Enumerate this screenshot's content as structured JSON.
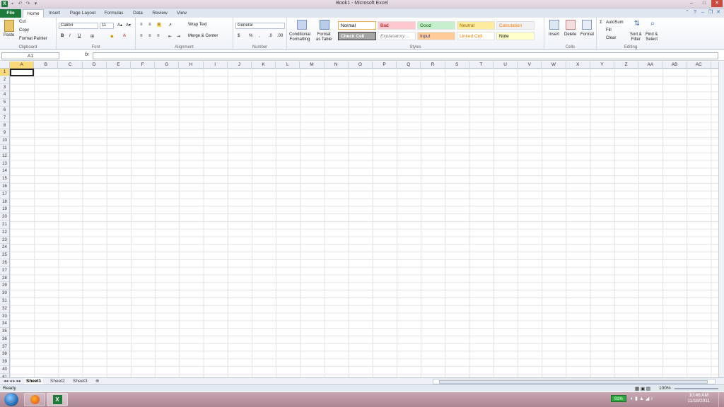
{
  "window": {
    "title": "Book1 - Microsoft Excel"
  },
  "tabs": [
    "File",
    "Home",
    "Insert",
    "Page Layout",
    "Formulas",
    "Data",
    "Review",
    "View"
  ],
  "ribbon": {
    "clipboard": {
      "label": "Clipboard",
      "paste": "Paste",
      "cut": "Cut",
      "copy": "Copy",
      "format_painter": "Format Painter"
    },
    "font": {
      "label": "Font",
      "family": "Calibri",
      "size": "11"
    },
    "alignment": {
      "label": "Alignment",
      "wrap": "Wrap Text",
      "merge": "Merge & Center"
    },
    "number": {
      "label": "Number",
      "format": "General"
    },
    "styles": {
      "label": "Styles",
      "conditional": "Conditional\nFormatting",
      "format_table": "Format\nas Table",
      "cells": [
        {
          "name": "Normal",
          "bg": "#ffffff",
          "fg": "#000000"
        },
        {
          "name": "Bad",
          "bg": "#ffc7ce",
          "fg": "#9c0006"
        },
        {
          "name": "Good",
          "bg": "#c6efce",
          "fg": "#006100"
        },
        {
          "name": "Neutral",
          "bg": "#ffeb9c",
          "fg": "#9c6500"
        },
        {
          "name": "Calculation",
          "bg": "#f2f2f2",
          "fg": "#fa7d00"
        },
        {
          "name": "Check Cell",
          "bg": "#a5a5a5",
          "fg": "#ffffff"
        },
        {
          "name": "Explanatory ...",
          "bg": "#ffffff",
          "fg": "#7f7f7f"
        },
        {
          "name": "Input",
          "bg": "#ffcc99",
          "fg": "#3f3f76"
        },
        {
          "name": "Linked Cell",
          "bg": "#ffffff",
          "fg": "#fa7d00"
        },
        {
          "name": "Note",
          "bg": "#ffffcc",
          "fg": "#000000"
        }
      ]
    },
    "cells": {
      "label": "Cells",
      "insert": "Insert",
      "delete": "Delete",
      "format": "Format"
    },
    "editing": {
      "label": "Editing",
      "autosum": "AutoSum",
      "fill": "Fill",
      "clear": "Clear",
      "sort": "Sort &\nFilter",
      "find": "Find &\nSelect"
    }
  },
  "formula_bar": {
    "name_box": "A1",
    "fx": "fx",
    "value": ""
  },
  "columns": [
    "A",
    "B",
    "C",
    "D",
    "E",
    "F",
    "G",
    "H",
    "I",
    "J",
    "K",
    "L",
    "M",
    "N",
    "O",
    "P",
    "Q",
    "R",
    "S",
    "T",
    "U",
    "V",
    "W",
    "X",
    "Y",
    "Z",
    "AA",
    "AB",
    "AC"
  ],
  "rows": 41,
  "sheets": [
    "Sheet1",
    "Sheet2",
    "Sheet3"
  ],
  "status": {
    "text": "Ready",
    "zoom": "100%"
  },
  "taskbar": {
    "battery": "91%",
    "time": "10:46 AM",
    "date": "11/18/2011"
  }
}
